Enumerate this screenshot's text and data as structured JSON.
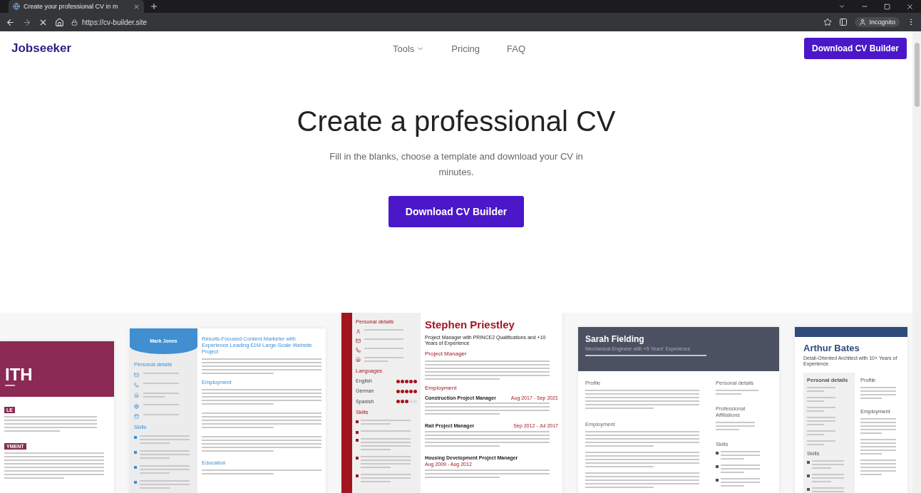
{
  "browser": {
    "tab_title": "Create your professional CV in m",
    "url": "https://cv-builder.site",
    "profile": "Incognito"
  },
  "header": {
    "logo": "Jobseeker",
    "nav": [
      {
        "label": "Tools",
        "dropdown": true
      },
      {
        "label": "Pricing",
        "dropdown": false
      },
      {
        "label": "FAQ",
        "dropdown": false
      }
    ],
    "cta": "Download CV Builder"
  },
  "hero": {
    "title": "Create a professional CV",
    "subtitle": "Fill in the blanks, choose a template and download your CV in minutes.",
    "button": "Download CV Builder"
  },
  "templates": [
    {
      "kind": "banner",
      "name": "ITH",
      "sections": [
        "LE",
        "YMENT"
      ]
    },
    {
      "kind": "blue-sidebar",
      "name": "Mark Jones",
      "headline": "Results-Focused Content Marketer with Experience Leading £1M Large-Scale Website Project",
      "side_sections": [
        "Personal details",
        "Skills"
      ],
      "sections": [
        "Employment",
        "Education"
      ]
    },
    {
      "kind": "red-sidebar",
      "name": "Stephen Priestley",
      "headline": "Project Manager with PRINCE2 Qualifications and +10 Years of Experience",
      "side_sections": [
        "Personal details",
        "Languages",
        "Skills"
      ],
      "languages": [
        {
          "name": "English",
          "stars": 5
        },
        {
          "name": "German",
          "stars": 5
        },
        {
          "name": "Spanish",
          "stars": 3
        }
      ],
      "sections": [
        "Project Manager",
        "Employment"
      ],
      "jobs": [
        {
          "title": "Construction Project Manager",
          "date": "Aug 2017 - Sep 2021"
        },
        {
          "title": "Rail Project Manager",
          "date": "Sep 2012 - Jul 2017"
        },
        {
          "title": "Housing Development Project Manager",
          "date": "Aug 2009 - Aug 2012"
        }
      ]
    },
    {
      "kind": "dark-header",
      "name": "Sarah Fielding",
      "headline": "Mechanical Engineer with +5 Years' Experience",
      "sections": [
        "Profile",
        "Employment"
      ],
      "side_sections": [
        "Personal details",
        "Professional Affiliations",
        "Skills"
      ]
    },
    {
      "kind": "top-bar",
      "name": "Arthur Bates",
      "headline": "Detail-Oriented Architect with 10+ Years of Experience",
      "side_sections": [
        "Personal details",
        "Skills"
      ],
      "sections": [
        "Profile",
        "Employment"
      ]
    }
  ]
}
